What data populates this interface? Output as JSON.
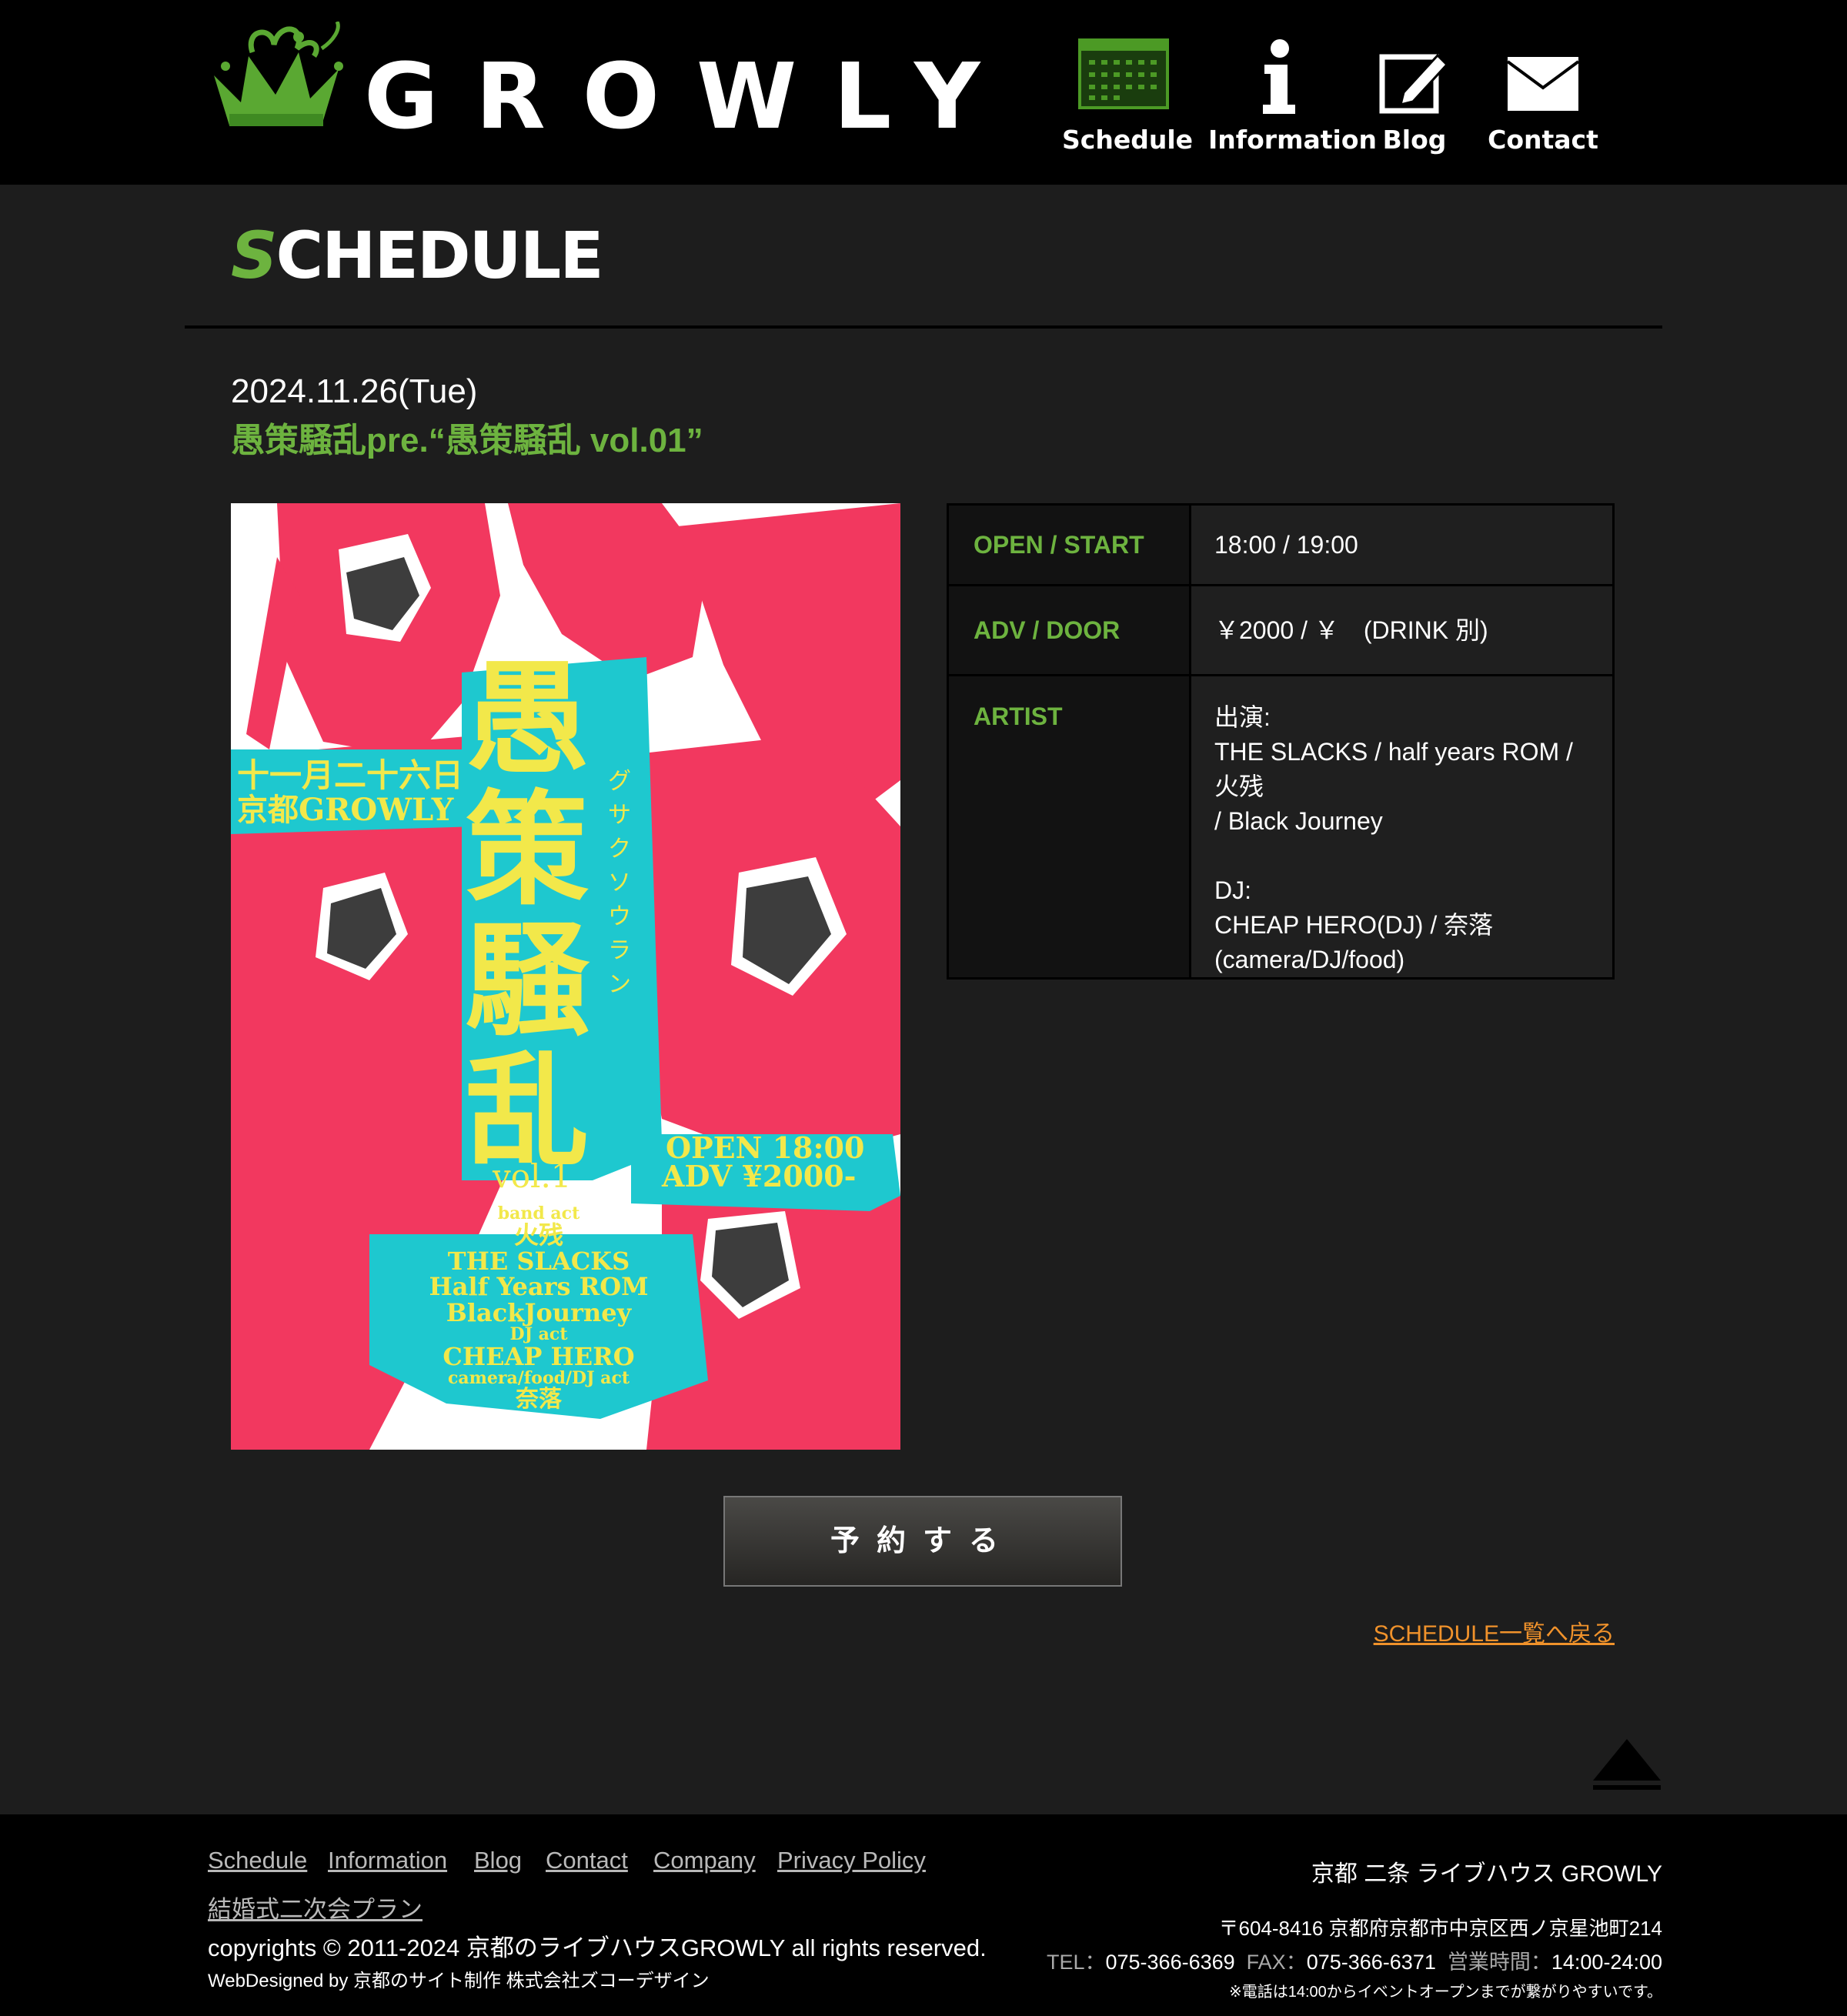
{
  "header": {
    "logo_text": "GROWLY",
    "nav": [
      {
        "label": "Schedule"
      },
      {
        "label": "Information"
      },
      {
        "label": "Blog"
      },
      {
        "label": "Contact"
      }
    ]
  },
  "page_title": {
    "first": "S",
    "rest": "CHEDULE"
  },
  "event": {
    "date": "2024.11.26(Tue)",
    "title": "愚策騒乱pre.“愚策騒乱 vol.01”",
    "table": {
      "open_label": "OPEN / START",
      "open_value": "18:00 / 19:00",
      "price_label": "ADV / DOOR",
      "price_value": "￥2000 / ￥　(DRINK 別)",
      "artist_label": "ARTIST",
      "artist_lines": [
        "出演:",
        "THE SLACKS / half years ROM / 火残",
        "/ Black Journey",
        "",
        "DJ:",
        "CHEAP HERO(DJ) / 奈落",
        "(camera/DJ/food)"
      ]
    },
    "reserve_label": "予約する",
    "back_link": "SCHEDULE一覧へ戻る"
  },
  "flyer": {
    "date_line1": "十一月二十六日",
    "date_line2": "京都GROWLY",
    "main_chars": [
      "愚",
      "策",
      "騒",
      "乱"
    ],
    "reading": "グサクソウラン",
    "vol": "vol.1",
    "open": "OPEN 18:00",
    "adv": "ADV ¥2000-",
    "band_act_label": "band act",
    "bands": [
      "火残",
      "THE SLACKS",
      "Half Years ROM",
      "BlackJourney"
    ],
    "dj_act_label": "DJ act",
    "dj": "CHEAP HERO",
    "camera_label": "camera/food/DJ act",
    "camera": "奈落"
  },
  "footer": {
    "links": [
      "Schedule",
      "Information",
      "Blog",
      "Contact",
      "Company",
      "Privacy Policy"
    ],
    "wedding_link": "結婚式二次会プラン",
    "copyright": "copyrights © 2011-2024 京都のライブハウスGROWLY all rights reserved.",
    "webdesigned": "WebDesigned by 京都のサイト制作 株式会社ズコーデザイン",
    "venue_name": "京都 二条 ライブハウス GROWLY",
    "address": "〒604-8416 京都府京都市中京区西ノ京星池町214",
    "tel_label": "TEL：",
    "tel": "075-366-6369",
    "fax_label": "FAX：",
    "fax": "075-366-6371",
    "hours_label": "営業時間：",
    "hours": "14:00-24:00",
    "phone_note": "※電話は14:00からイベントオープンまでが繋がりやすいです。"
  },
  "colors": {
    "accent_green": "#6db33f",
    "link_orange": "#f0922b",
    "flyer_pink": "#f2385f",
    "flyer_cyan": "#1ec8cf",
    "flyer_yellow": "#f2e84a"
  }
}
